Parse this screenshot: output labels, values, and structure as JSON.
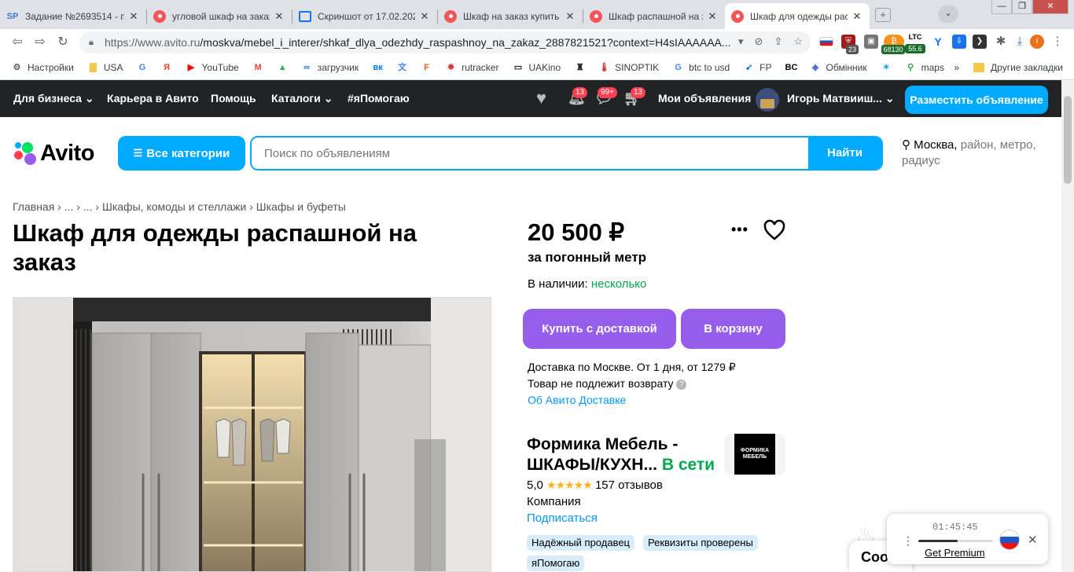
{
  "browser": {
    "tabs": [
      {
        "favicon": "sp",
        "label": "Задание №2693514 - п"
      },
      {
        "favicon": "avito",
        "label": "угловой шкаф на заказ"
      },
      {
        "favicon": "screenshot",
        "label": "Скриншот от 17.02.2023"
      },
      {
        "favicon": "avito",
        "label": "Шкаф на заказ купить"
      },
      {
        "favicon": "avito",
        "label": "Шкаф распашной на за"
      },
      {
        "favicon": "avito",
        "label": "Шкаф для одежды рас"
      }
    ],
    "url_host": "https://www.avito.ru",
    "url_path": "/moskva/mebel_i_interer/shkaf_dlya_odezhdy_raspashnoy_na_zakaz_2887821521?context=H4sIAAAAAA...",
    "extensions": {
      "badge_23": "23",
      "btc_price": "68130",
      "ltc_label": "LTC",
      "ltc_price": "55.6",
      "profile_initial": "I"
    },
    "bookmarks": [
      {
        "icon": "gear-icon",
        "label": "Настройки"
      },
      {
        "icon": "folder-icon",
        "label": "USA"
      },
      {
        "icon": "google-icon",
        "label": ""
      },
      {
        "icon": "yandex-icon",
        "label": ""
      },
      {
        "icon": "youtube-icon",
        "label": "YouTube"
      },
      {
        "icon": "gmail-icon",
        "label": ""
      },
      {
        "icon": "drive-icon",
        "label": ""
      },
      {
        "icon": "loader-icon",
        "label": "загрузчик"
      },
      {
        "icon": "vk-icon",
        "label": ""
      },
      {
        "icon": "translate-icon",
        "label": ""
      },
      {
        "icon": "f-icon",
        "label": ""
      },
      {
        "icon": "rutracker-icon",
        "label": "rutracker"
      },
      {
        "icon": "uakino-icon",
        "label": "UAKino"
      },
      {
        "icon": "chess-icon",
        "label": ""
      },
      {
        "icon": "thermometer-icon",
        "label": "SINOPTIK"
      },
      {
        "icon": "google-icon",
        "label": "btc to usd"
      },
      {
        "icon": "fp-icon",
        "label": "FP"
      },
      {
        "icon": "bc-icon",
        "label": ""
      },
      {
        "icon": "exchange-icon",
        "label": "Обмінник"
      },
      {
        "icon": "star-icon",
        "label": ""
      },
      {
        "icon": "maps-icon",
        "label": "maps"
      }
    ],
    "bookmarks_overflow": "»",
    "other_bookmarks": "Другие закладки"
  },
  "header": {
    "business": "Для бизнеса",
    "career": "Карьера в Авито",
    "help": "Помощь",
    "catalogs": "Каталоги",
    "ya_help": "#яПомогаю",
    "notifications_count": "13",
    "messages_count": "99+",
    "cart_count": "13",
    "my_ads": "Мои объявления",
    "user_name": "Игорь Матвииш...",
    "place_ad": "Разместить объявление"
  },
  "search": {
    "logo": "Avito",
    "all_categories": "Все категории",
    "placeholder": "Поиск по объявлениям",
    "find": "Найти",
    "location_city": "Москва,",
    "location_rest": " район, метро, радиус"
  },
  "breadcrumbs": [
    "Главная",
    "...",
    "...",
    "Шкафы, комоды и стеллажи",
    "Шкафы и буфеты"
  ],
  "listing": {
    "title": "Шкаф для одежды распашной на заказ",
    "price": "20 500 ₽",
    "price_unit": "за погонный метр",
    "stock_label": "В наличии: ",
    "stock_value": "несколько",
    "buy_button": "Купить с доставкой",
    "cart_button": "В корзину",
    "delivery_info": "Доставка по Москве. От 1 дня, от 1279 ₽",
    "no_return": "Товар не подлежит возврату",
    "delivery_link": "Об Авито Доставке"
  },
  "seller": {
    "name": "Формика Мебель - ШКАФЫ/КУХН...",
    "online": "В сети",
    "logo_text": "ФОРМИКА МЕБЕЛЬ",
    "rating": "5,0",
    "stars": "★★★★★",
    "reviews": "157 отзывов",
    "type": "Компания",
    "subscribe": "Подписаться",
    "badges": [
      "Надёжный продавец",
      "Реквизиты проверены",
      "яПомогаю"
    ]
  },
  "widgets": {
    "chat_text": "Coo",
    "player_time": "01:45:45",
    "player_progress": 0.53,
    "get_premium": "Get Premium"
  }
}
